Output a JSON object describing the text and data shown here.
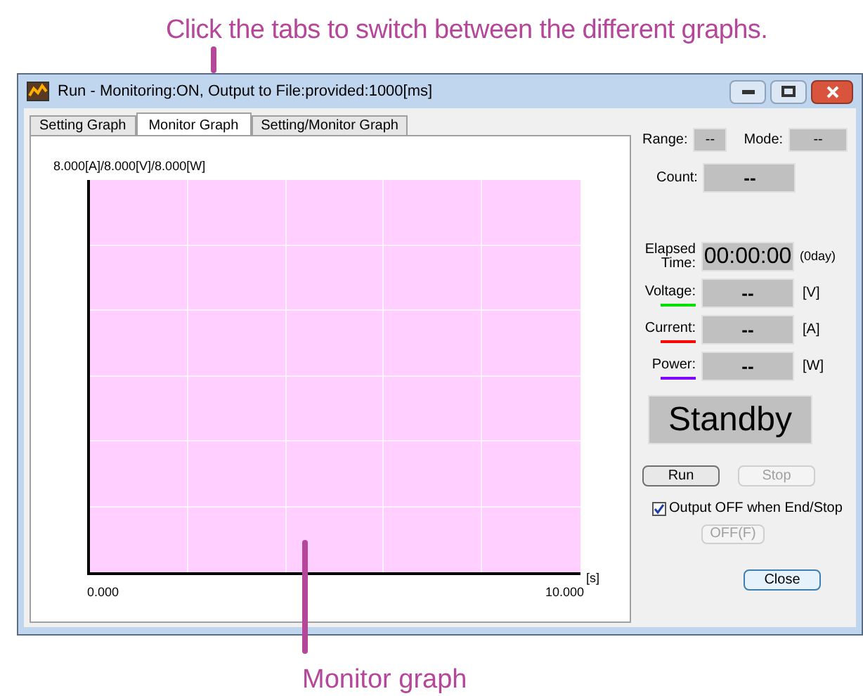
{
  "annotations": [
    {
      "text": "Click the tabs to switch between the different graphs."
    },
    {
      "text": "Monitor graph"
    }
  ],
  "window": {
    "title": "Run - Monitoring:ON, Output to File:provided:1000[ms]"
  },
  "tabs": [
    {
      "label": "Setting Graph",
      "selected": false
    },
    {
      "label": "Monitor Graph",
      "selected": true
    },
    {
      "label": "Setting/Monitor Graph",
      "selected": false
    }
  ],
  "graph": {
    "y_label": "8.000[A]/8.000[V]/8.000[W]",
    "x_start": "0.000",
    "x_end": "10.000",
    "x_unit": "[s]"
  },
  "range": {
    "label": "Range:",
    "value": "--"
  },
  "mode": {
    "label": "Mode:",
    "value": "--"
  },
  "count": {
    "label": "Count:",
    "value": "--"
  },
  "elapsed": {
    "label": "Elapsed Time:",
    "value": "00:00:00",
    "days": "(0day)"
  },
  "readings": [
    {
      "label": "Voltage:",
      "color": "#00e000",
      "value": "--",
      "unit": "[V]"
    },
    {
      "label": "Current:",
      "color": "#ff0000",
      "value": "--",
      "unit": "[A]"
    },
    {
      "label": "Power:",
      "color": "#8000ff",
      "value": "--",
      "unit": "[W]"
    }
  ],
  "status": "Standby",
  "run_buttons": [
    {
      "label": "Run",
      "disabled": false
    },
    {
      "label": "Stop",
      "disabled": true
    }
  ],
  "output_off": {
    "label": "Output OFF when End/Stop",
    "checked": true
  },
  "off_button": {
    "label": "OFF(F)",
    "disabled": true
  },
  "close_button": {
    "label": "Close",
    "disabled": false
  }
}
